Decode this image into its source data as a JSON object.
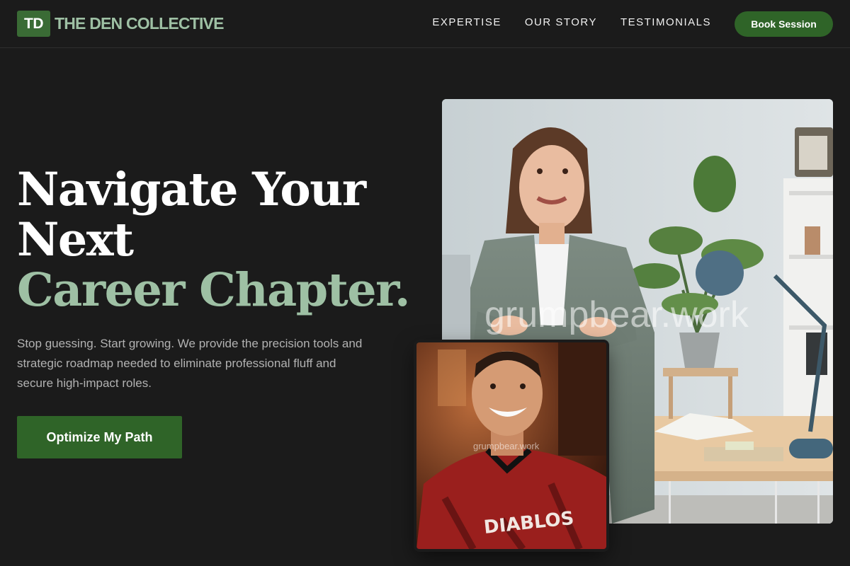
{
  "brand": {
    "mark": "TD",
    "name": "THE DEN COLLECTIVE"
  },
  "nav": {
    "links": [
      "EXPERTISE",
      "OUR STORY",
      "TESTIMONIALS"
    ],
    "cta": "Book Session"
  },
  "hero": {
    "headline_line1": "Navigate Your",
    "headline_line2": "Next",
    "headline_accent": "Career Chapter.",
    "description": "Stop guessing. Start growing. We provide the precision tools and strategic roadmap needed to eliminate professional fluff and secure high-impact roles.",
    "cta": "Optimize My Path"
  },
  "images": {
    "main_watermark": "grumpbear.work",
    "inset_watermark": "grumpbear.work",
    "jersey_text": "DIABLOS"
  },
  "colors": {
    "background": "#1b1b1b",
    "brand_green": "#2f6428",
    "accent_sage": "#9ec0a4"
  }
}
